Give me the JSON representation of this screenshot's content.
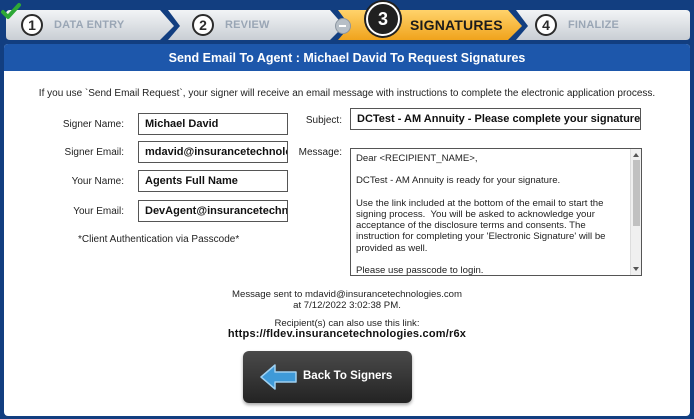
{
  "wizard": {
    "steps": [
      {
        "number": "1",
        "label": "DATA ENTRY"
      },
      {
        "number": "2",
        "label": "REVIEW"
      },
      {
        "number": "3",
        "label": "SIGNATURES"
      },
      {
        "number": "4",
        "label": "FINALIZE"
      }
    ],
    "active_step": 3
  },
  "panel": {
    "title": "Send Email To Agent : Michael David To Request Signatures",
    "intro": "If you use `Send Email Request`, your signer will receive an email message with instructions to complete the electronic application process."
  },
  "form": {
    "signer_name_label": "Signer Name:",
    "signer_name_value": "Michael David",
    "signer_email_label": "Signer Email:",
    "signer_email_value": "mdavid@insurancetechnologies.com",
    "your_name_label": "Your Name:",
    "your_name_value": "Agents Full Name",
    "your_email_label": "Your Email:",
    "your_email_value": "DevAgent@insurancetechnologies.com",
    "auth_note": "*Client Authentication via Passcode*",
    "subject_label": "Subject:",
    "subject_value": "DCTest - AM Annuity - Please complete your signature",
    "message_label": "Message:",
    "message_value": "Dear <RECIPIENT_NAME>,\n\nDCTest - AM Annuity is ready for your signature.\n\nUse the link included at the bottom of the email to start the signing process.  You will be asked to acknowledge your acceptance of the disclosure terms and consents. The instruction for completing your 'Electronic Signature' will be provided as well.\n\nPlease use passcode to login.\n\nIf you have any questions please feel free to contact me.\nIf you need help signing, please watch this short guide:"
  },
  "status": {
    "sent_line1": "Message sent to mdavid@insurancetechnologies.com",
    "sent_line2": "at 7/12/2022 3:02:38 PM.",
    "link_label": "Recipient(s) can also use this link:",
    "link_url": "https://fldev.insurancetechnologies.com/r6x"
  },
  "buttons": {
    "back_label": "Back To Signers"
  },
  "colors": {
    "frame_blue": "#123e80",
    "header_blue": "#1d57ab",
    "active_step": "#f5a623",
    "check_green": "#2ea836",
    "arrow_blue": "#3f9ad8"
  }
}
